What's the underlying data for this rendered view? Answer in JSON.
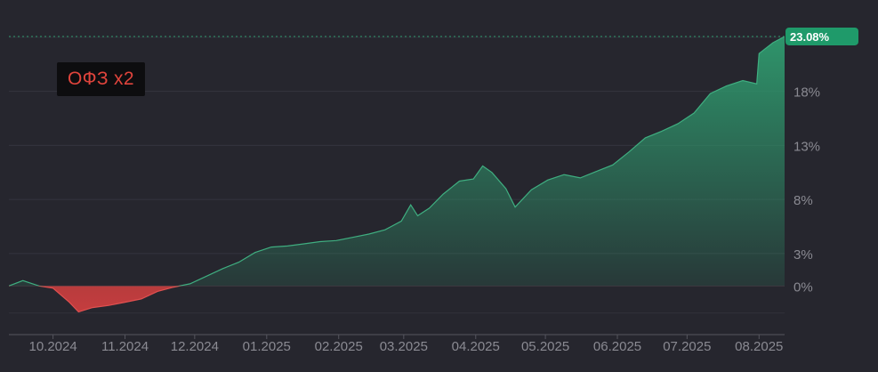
{
  "chart_data": {
    "type": "area",
    "series": [
      {
        "name": "ОФЗ x2",
        "x": [
          "2024-09-12",
          "2024-09-18",
          "2024-09-25",
          "2024-10-01",
          "2024-10-08",
          "2024-10-12",
          "2024-10-18",
          "2024-10-25",
          "2024-11-01",
          "2024-11-08",
          "2024-11-15",
          "2024-11-22",
          "2024-11-29",
          "2024-12-06",
          "2024-12-13",
          "2024-12-20",
          "2024-12-27",
          "2025-01-03",
          "2025-01-10",
          "2025-01-17",
          "2025-01-24",
          "2025-01-31",
          "2025-02-07",
          "2025-02-14",
          "2025-02-21",
          "2025-02-28",
          "2025-03-04",
          "2025-03-07",
          "2025-03-12",
          "2025-03-18",
          "2025-03-25",
          "2025-03-31",
          "2025-04-04",
          "2025-04-08",
          "2025-04-14",
          "2025-04-18",
          "2025-04-25",
          "2025-05-02",
          "2025-05-09",
          "2025-05-16",
          "2025-05-23",
          "2025-05-30",
          "2025-06-06",
          "2025-06-13",
          "2025-06-20",
          "2025-06-27",
          "2025-07-04",
          "2025-07-11",
          "2025-07-18",
          "2025-07-25",
          "2025-07-31",
          "2025-08-01",
          "2025-08-07",
          "2025-08-12"
        ],
        "values": [
          0.0,
          0.5,
          0.0,
          -0.2,
          -1.5,
          -2.4,
          -2.0,
          -1.8,
          -1.5,
          -1.2,
          -0.5,
          -0.1,
          0.2,
          0.9,
          1.6,
          2.2,
          3.1,
          3.6,
          3.7,
          3.9,
          4.1,
          4.2,
          4.5,
          4.8,
          5.2,
          6.0,
          7.5,
          6.5,
          7.2,
          8.5,
          9.7,
          9.9,
          11.1,
          10.5,
          9.0,
          7.3,
          8.9,
          9.8,
          10.3,
          10.0,
          10.6,
          11.2,
          12.4,
          13.7,
          14.3,
          15.0,
          16.0,
          17.8,
          18.5,
          19.0,
          18.7,
          21.5,
          22.5,
          23.08
        ]
      }
    ],
    "y_ticks": [
      "0%",
      "3%",
      "8%",
      "13%",
      "18%"
    ],
    "x_ticks": [
      "10.2024",
      "11.2024",
      "12.2024",
      "01.2025",
      "02.2025",
      "03.2025",
      "04.2025",
      "05.2025",
      "06.2025",
      "07.2025",
      "08.2025"
    ],
    "ylim": [
      -4.5,
      25.3
    ],
    "current_value_label": "23.08%",
    "grid": true,
    "colors": {
      "positive": "#2f9a6e",
      "negative": "#d64040",
      "badge": "#1f9a6a",
      "legend_text": "#e0443c"
    }
  }
}
